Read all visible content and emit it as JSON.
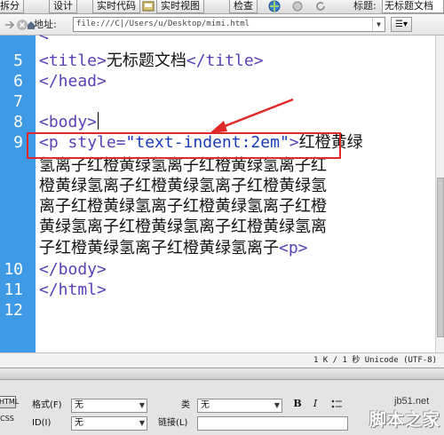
{
  "toolbar": {
    "items": [
      "拆分",
      "设计",
      "实时代码",
      "实时视图",
      "检查"
    ],
    "title_label": "标题:",
    "title_value": "无标题文档"
  },
  "address": {
    "label": "地址:",
    "value": "file:///C|/Users/u/Desktop/mimi.html"
  },
  "editor": {
    "line_numbers": [
      "5",
      "6",
      "7",
      "8",
      "9",
      "10",
      "11",
      "12"
    ],
    "line5": {
      "open": "<title>",
      "text": "无标题文档",
      "close": "</title>"
    },
    "line6": "</head>",
    "line8": "<body>",
    "line9": {
      "tag_open": "<p ",
      "attr_name": "style=",
      "attr_value": "\"text-indent:2em\"",
      "tag_close": ">",
      "text": "红橙黄绿"
    },
    "wrap_lines": [
      "氢离子红橙黄绿氢离子红橙黄绿氢离子红",
      "橙黄绿氢离子红橙黄绿氢离子红橙黄绿氢",
      "离子红橙黄绿氢离子红橙黄绿氢离子红橙",
      "黄绿氢离子红橙黄绿氢离子红橙黄绿氢离",
      "子红橙黄绿氢离子红橙黄绿氢离子"
    ],
    "wrap_last_tag": "<p>",
    "line10": "</body>",
    "line11": "</html>",
    "highlight_color": "#e02a2a"
  },
  "status": {
    "text": "1 K / 1 秒  Unicode (UTF-8)"
  },
  "properties": {
    "mode_html": "HTML",
    "mode_css": "CSS",
    "format_label": "格式(F)",
    "format_value": "无",
    "class_label": "类",
    "class_value": "无",
    "id_label": "ID(I)",
    "id_value": "无",
    "link_label": "链接(L)",
    "bold": "B",
    "italic": "I"
  },
  "watermark": {
    "site": "jb51.net",
    "name": "脚本之家"
  }
}
